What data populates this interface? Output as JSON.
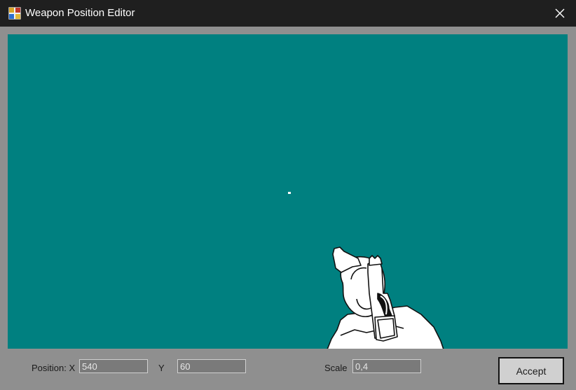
{
  "window": {
    "title": "Weapon Position Editor",
    "app_icon": "window-app-icon",
    "close_icon": "close-icon"
  },
  "viewport": {
    "background_color": "#008080",
    "weapon": "revolver-in-hand-sprite",
    "crosshair": "crosshair-dot"
  },
  "controls": {
    "position_label": "Position: X",
    "x_value": "540",
    "y_label": "Y",
    "y_value": "60",
    "scale_label": "Scale",
    "scale_value": "0,4",
    "accept_label": "Accept"
  },
  "colors": {
    "titlebar": "#1f1f1f",
    "window_bg": "#8f8f8f",
    "viewport_bg": "#008080",
    "field_bg": "#7a7a7a"
  }
}
